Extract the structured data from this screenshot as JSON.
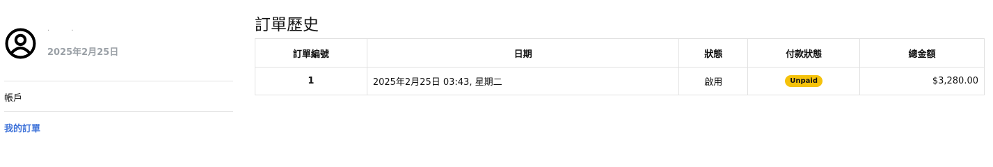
{
  "sidebar": {
    "profile": {
      "name": ". .",
      "date": "2025年2月25日"
    },
    "nav": [
      {
        "label": "帳戶"
      },
      {
        "label": "我的訂單",
        "active": true
      }
    ],
    "active_color": "#3f73d9"
  },
  "main": {
    "title": "訂單歷史",
    "table": {
      "headers": [
        "訂單編號",
        "日期",
        "狀態",
        "付款狀態",
        "總金額"
      ],
      "rows": [
        {
          "order_no": "1",
          "date": "2025年2月25日 03:43, 星期二",
          "status": "啟用",
          "payment_status": "Unpaid",
          "total": "$3,280.00"
        }
      ]
    },
    "badge_color": "#f5c20b"
  },
  "icons": {
    "avatar": "user-circle-icon"
  }
}
